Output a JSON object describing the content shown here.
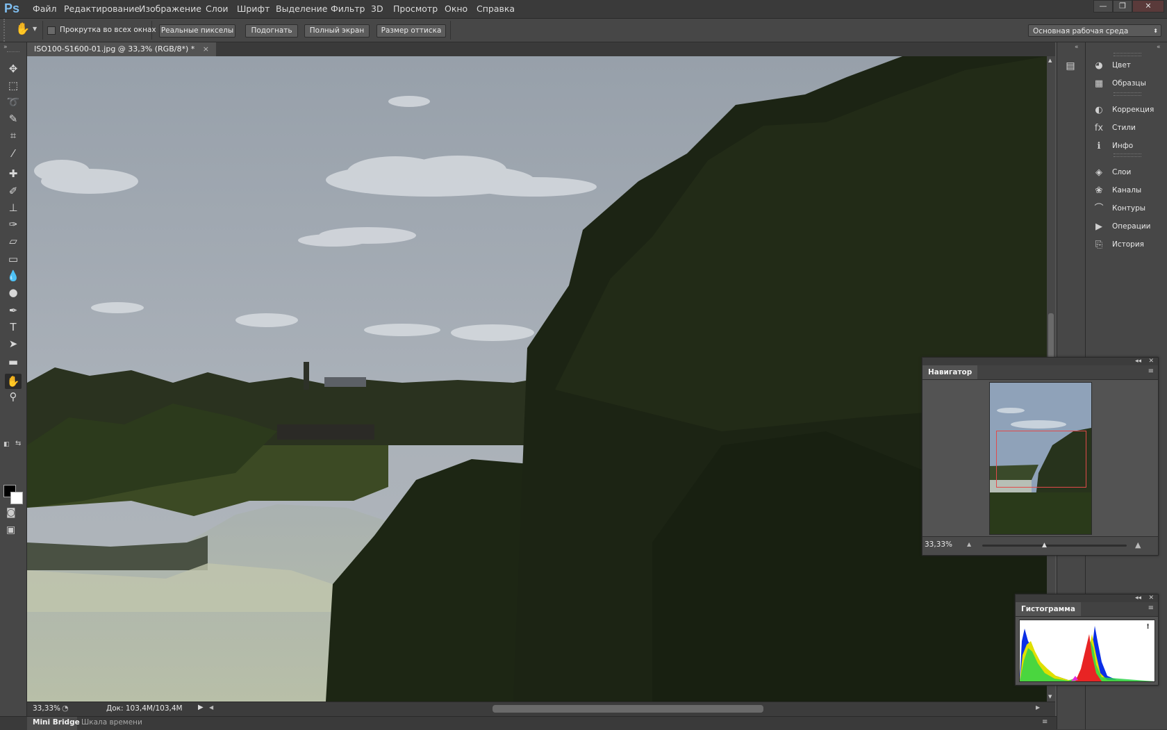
{
  "app": {
    "logo": "Ps"
  },
  "menu": [
    "Файл",
    "Редактирование",
    "Изображение",
    "Слои",
    "Шрифт",
    "Выделение",
    "Фильтр",
    "3D",
    "Просмотр",
    "Окно",
    "Справка"
  ],
  "window_controls": {
    "minimize": "—",
    "restore": "❐",
    "close": "✕"
  },
  "options": {
    "scroll_all_label": "Прокрутка во всех окнах",
    "actual_pixels": "Реальные пикселы",
    "fit_screen": "Подогнать",
    "full_screen": "Полный экран",
    "print_size": "Размер оттиска",
    "workspace": "Основная рабочая среда"
  },
  "document": {
    "tab_title": "ISO100-S1600-01.jpg @ 33,3% (RGB/8*) *",
    "tab_close": "×"
  },
  "status": {
    "zoom": "33,33%",
    "doc_size": "Док: 103,4M/103,4M"
  },
  "bottom_tabs": [
    "Mini Bridge",
    "Шкала времени"
  ],
  "dock": {
    "items": [
      {
        "label": "Цвет",
        "icon": "color-icon",
        "glyph": "◕"
      },
      {
        "label": "Образцы",
        "icon": "swatches-icon",
        "glyph": "▦"
      },
      {
        "label": "Коррекция",
        "icon": "adjustments-icon",
        "glyph": "◐"
      },
      {
        "label": "Стили",
        "icon": "styles-icon",
        "glyph": "fx"
      },
      {
        "label": "Инфо",
        "icon": "info-icon",
        "glyph": "ℹ"
      },
      {
        "label": "Слои",
        "icon": "layers-icon",
        "glyph": "◈"
      },
      {
        "label": "Каналы",
        "icon": "channels-icon",
        "glyph": "❀"
      },
      {
        "label": "Контуры",
        "icon": "paths-icon",
        "glyph": "⌒"
      },
      {
        "label": "Операции",
        "icon": "actions-icon",
        "glyph": "▶"
      },
      {
        "label": "История",
        "icon": "history-icon",
        "glyph": "⎘"
      }
    ]
  },
  "navigator": {
    "title": "Навигатор",
    "zoom": "33,33%",
    "zoom_level": 0.33
  },
  "histogram": {
    "title": "Гистограмма",
    "warning": "!"
  },
  "tools": [
    {
      "name": "move-tool-icon",
      "glyph": "✥"
    },
    {
      "name": "marquee-tool-icon",
      "glyph": "⬚"
    },
    {
      "name": "lasso-tool-icon",
      "glyph": "➰"
    },
    {
      "name": "quick-selection-tool-icon",
      "glyph": "✎"
    },
    {
      "name": "crop-tool-icon",
      "glyph": "⌗"
    },
    {
      "name": "eyedropper-tool-icon",
      "glyph": "⁄"
    },
    {
      "name": "healing-brush-tool-icon",
      "glyph": "✚"
    },
    {
      "name": "brush-tool-icon",
      "glyph": "✐"
    },
    {
      "name": "clone-stamp-tool-icon",
      "glyph": "⊥"
    },
    {
      "name": "history-brush-tool-icon",
      "glyph": "✑"
    },
    {
      "name": "eraser-tool-icon",
      "glyph": "▱"
    },
    {
      "name": "gradient-tool-icon",
      "glyph": "▭"
    },
    {
      "name": "blur-tool-icon",
      "glyph": "💧"
    },
    {
      "name": "dodge-tool-icon",
      "glyph": "●"
    },
    {
      "name": "pen-tool-icon",
      "glyph": "✒"
    },
    {
      "name": "type-tool-icon",
      "glyph": "T"
    },
    {
      "name": "path-selection-tool-icon",
      "glyph": "➤"
    },
    {
      "name": "shape-tool-icon",
      "glyph": "▬"
    },
    {
      "name": "hand-tool-icon",
      "glyph": "✋"
    },
    {
      "name": "zoom-tool-icon",
      "glyph": "⚲"
    }
  ]
}
